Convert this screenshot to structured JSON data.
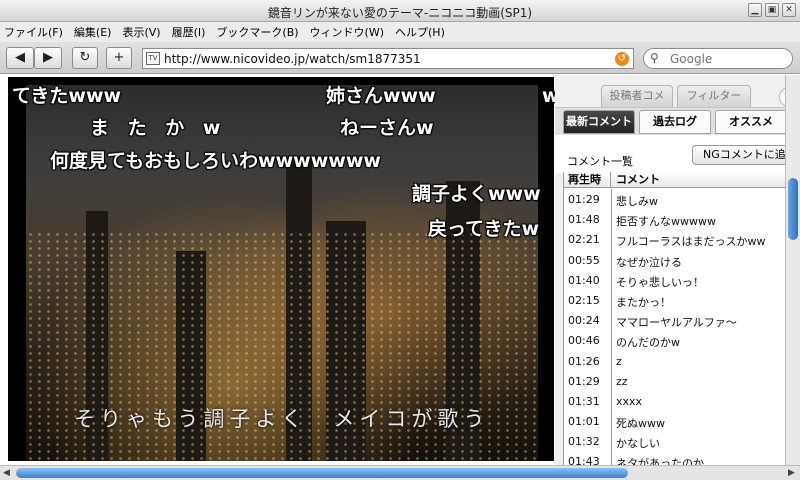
{
  "window": {
    "title": "鏡音リンが来ない愛のテーマ-ニコニコ動画(SP1)"
  },
  "menu": [
    "ファイル(F)",
    "編集(E)",
    "表示(V)",
    "履歴(I)",
    "ブックマーク(B)",
    "ウィンドウ(W)",
    "ヘルプ(H)"
  ],
  "nav": {
    "back": "◀",
    "forward": "▶",
    "reload": "↻",
    "add": "+",
    "url": "http://www.nicovideo.jp/watch/sm1877351",
    "search_placeholder": "Google"
  },
  "video": {
    "caption": "そりゃもう調子よく　メイコが歌う",
    "comments": [
      "てきたwww",
      "姉さんwww",
      "w",
      "ま た か w",
      "ねーさんw",
      "何度見てもおもしろいわwwwwwww",
      "調子よくwww",
      "戻ってきたw"
    ]
  },
  "panel": {
    "tabs_top": [
      "投稿者コメ",
      "フィルター"
    ],
    "tabs": [
      "最新コメント",
      "過去ログ",
      "オススメ"
    ],
    "list_title": "コメント一覧",
    "ng_button": "NGコメントに追加",
    "col_time": "再生時",
    "col_comment": "コメント",
    "rows": [
      {
        "time": "01:29",
        "text": "悲しみw"
      },
      {
        "time": "01:48",
        "text": "拒否すんなwwwww"
      },
      {
        "time": "02:21",
        "text": "フルコーラスはまだっスかww"
      },
      {
        "time": "00:55",
        "text": "なぜか泣ける"
      },
      {
        "time": "01:40",
        "text": "そりゃ悲しいっ！"
      },
      {
        "time": "02:15",
        "text": "またかっ！"
      },
      {
        "time": "00:24",
        "text": "ママローヤルアルファ〜"
      },
      {
        "time": "00:46",
        "text": "のんだのかw"
      },
      {
        "time": "01:26",
        "text": "z"
      },
      {
        "time": "01:29",
        "text": "zz"
      },
      {
        "time": "01:31",
        "text": "xxxx"
      },
      {
        "time": "01:01",
        "text": "死ぬwww"
      },
      {
        "time": "01:32",
        "text": "かなしい"
      },
      {
        "time": "01:43",
        "text": "ネタがあったのか"
      }
    ]
  }
}
